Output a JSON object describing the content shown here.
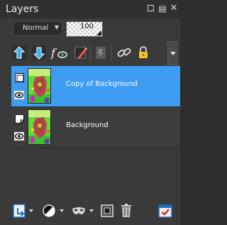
{
  "window": {
    "title": "Layers",
    "buttons": {
      "restore": "restore",
      "pin": "pin",
      "close": "close"
    }
  },
  "blend": {
    "mode": "Normal",
    "opacity": "100"
  },
  "toolbar": {
    "icons": [
      "new-layer-icon",
      "merge-down-icon",
      "layer-effects-icon",
      "mask-icon",
      "adjustment-layer-icon",
      "link-icon",
      "lock-icon",
      "panel-menu-icon"
    ]
  },
  "layers": [
    {
      "name": "Copy of Background",
      "selected": true,
      "visible": true
    },
    {
      "name": "Background",
      "selected": false,
      "visible": true
    }
  ],
  "colors": {
    "accent": "#3e9cf3",
    "panel": "#3a3a3a",
    "titlebar": "#303030"
  }
}
